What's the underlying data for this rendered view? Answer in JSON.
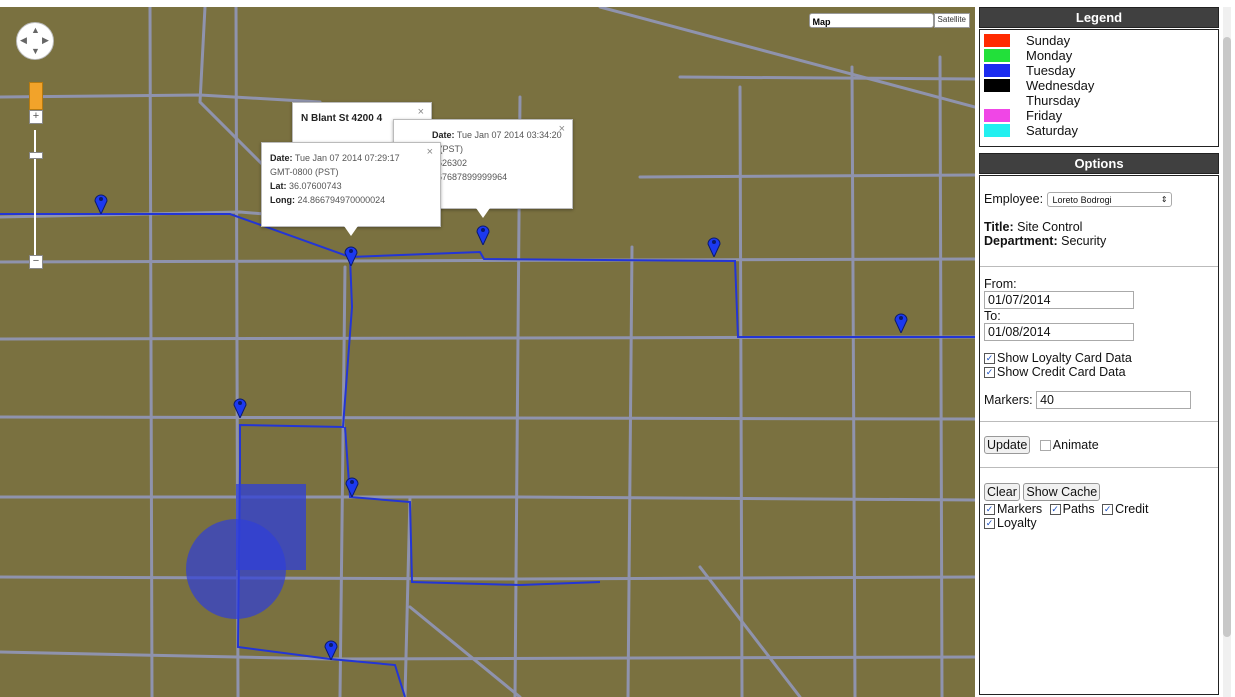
{
  "map": {
    "type_buttons": [
      "Map",
      "Satellite"
    ],
    "zoom_in": "+",
    "zoom_out": "−",
    "infowindows": [
      {
        "title": "N Blant St 4200 4",
        "close": "×"
      },
      {
        "date_label": "Date:",
        "date": "Tue Jan 07 2014 03:34:20",
        "line2": "0 (PST)",
        "line3": "7626302",
        "line4": "867687899999964",
        "close": "×"
      },
      {
        "date_label": "Date:",
        "date": "Tue Jan 07 2014 07:29:17",
        "tz": "GMT-0800 (PST)",
        "lat_label": "Lat:",
        "lat": "36.07600743",
        "long_label": "Long:",
        "long": "24.866794970000024",
        "close": "×"
      }
    ],
    "colors": {
      "background": "#7a7140",
      "road": "#8f93ad",
      "path": "#2335d6",
      "marker": "#1c39f0"
    }
  },
  "legend": {
    "title": "Legend",
    "items": [
      {
        "label": "Sunday",
        "color": "#ff2a00"
      },
      {
        "label": "Monday",
        "color": "#22e03a"
      },
      {
        "label": "Tuesday",
        "color": "#1b2cf0"
      },
      {
        "label": "Wednesday",
        "color": "#000000"
      },
      {
        "label": "Thursday",
        "color": "#ffffff"
      },
      {
        "label": "Friday",
        "color": "#f046e6"
      },
      {
        "label": "Saturday",
        "color": "#22f0f0"
      }
    ]
  },
  "options": {
    "title": "Options",
    "employee_label": "Employee:",
    "employee_value": "Loreto Bodrogi",
    "title_label": "Title:",
    "title_value": "Site Control",
    "dept_label": "Department:",
    "dept_value": "Security",
    "from_label": "From:",
    "from_value": "01/07/2014",
    "to_label": "To:",
    "to_value": "01/08/2014",
    "show_loyalty": "Show Loyalty Card Data",
    "show_credit": "Show Credit Card Data",
    "markers_label": "Markers:",
    "markers_value": "40",
    "update": "Update",
    "animate": "Animate",
    "clear": "Clear",
    "show_cache": "Show Cache",
    "cb_markers": "Markers",
    "cb_paths": "Paths",
    "cb_credit": "Credit",
    "cb_loyalty": "Loyalty"
  }
}
